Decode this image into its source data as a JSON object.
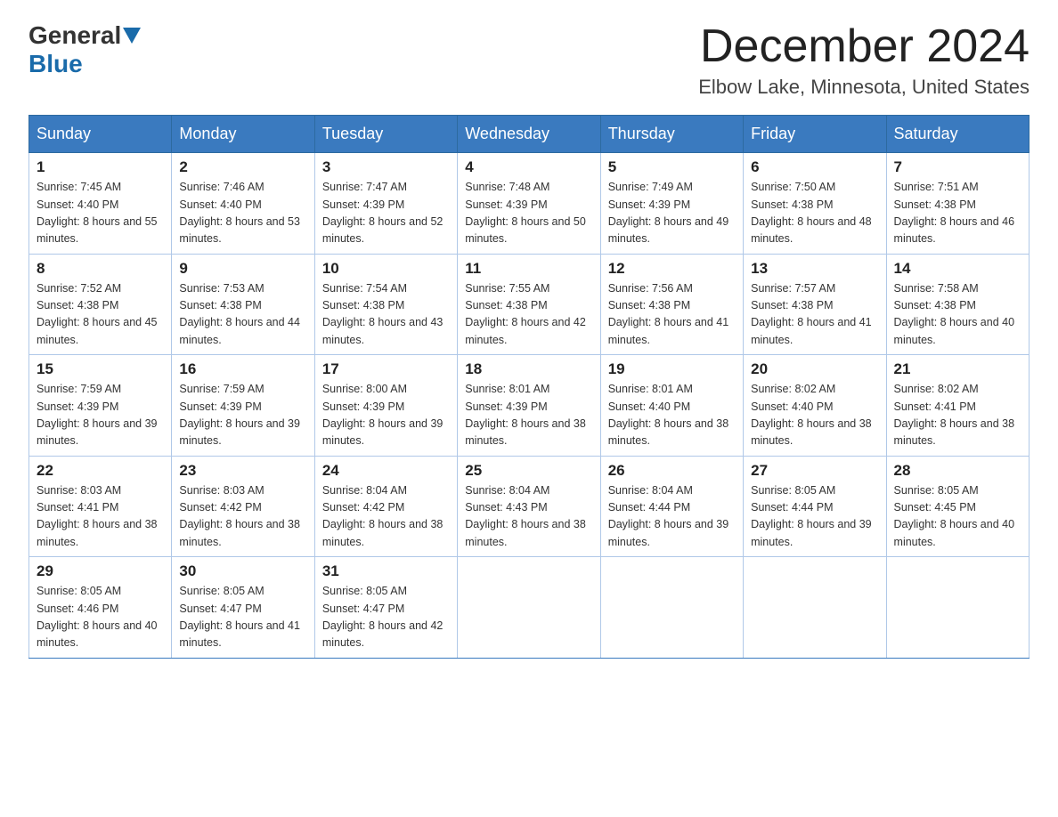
{
  "header": {
    "logo_general": "General",
    "logo_blue": "Blue",
    "month_title": "December 2024",
    "location": "Elbow Lake, Minnesota, United States"
  },
  "weekdays": [
    "Sunday",
    "Monday",
    "Tuesday",
    "Wednesday",
    "Thursday",
    "Friday",
    "Saturday"
  ],
  "weeks": [
    [
      {
        "day": "1",
        "sunrise": "7:45 AM",
        "sunset": "4:40 PM",
        "daylight": "8 hours and 55 minutes."
      },
      {
        "day": "2",
        "sunrise": "7:46 AM",
        "sunset": "4:40 PM",
        "daylight": "8 hours and 53 minutes."
      },
      {
        "day": "3",
        "sunrise": "7:47 AM",
        "sunset": "4:39 PM",
        "daylight": "8 hours and 52 minutes."
      },
      {
        "day": "4",
        "sunrise": "7:48 AM",
        "sunset": "4:39 PM",
        "daylight": "8 hours and 50 minutes."
      },
      {
        "day": "5",
        "sunrise": "7:49 AM",
        "sunset": "4:39 PM",
        "daylight": "8 hours and 49 minutes."
      },
      {
        "day": "6",
        "sunrise": "7:50 AM",
        "sunset": "4:38 PM",
        "daylight": "8 hours and 48 minutes."
      },
      {
        "day": "7",
        "sunrise": "7:51 AM",
        "sunset": "4:38 PM",
        "daylight": "8 hours and 46 minutes."
      }
    ],
    [
      {
        "day": "8",
        "sunrise": "7:52 AM",
        "sunset": "4:38 PM",
        "daylight": "8 hours and 45 minutes."
      },
      {
        "day": "9",
        "sunrise": "7:53 AM",
        "sunset": "4:38 PM",
        "daylight": "8 hours and 44 minutes."
      },
      {
        "day": "10",
        "sunrise": "7:54 AM",
        "sunset": "4:38 PM",
        "daylight": "8 hours and 43 minutes."
      },
      {
        "day": "11",
        "sunrise": "7:55 AM",
        "sunset": "4:38 PM",
        "daylight": "8 hours and 42 minutes."
      },
      {
        "day": "12",
        "sunrise": "7:56 AM",
        "sunset": "4:38 PM",
        "daylight": "8 hours and 41 minutes."
      },
      {
        "day": "13",
        "sunrise": "7:57 AM",
        "sunset": "4:38 PM",
        "daylight": "8 hours and 41 minutes."
      },
      {
        "day": "14",
        "sunrise": "7:58 AM",
        "sunset": "4:38 PM",
        "daylight": "8 hours and 40 minutes."
      }
    ],
    [
      {
        "day": "15",
        "sunrise": "7:59 AM",
        "sunset": "4:39 PM",
        "daylight": "8 hours and 39 minutes."
      },
      {
        "day": "16",
        "sunrise": "7:59 AM",
        "sunset": "4:39 PM",
        "daylight": "8 hours and 39 minutes."
      },
      {
        "day": "17",
        "sunrise": "8:00 AM",
        "sunset": "4:39 PM",
        "daylight": "8 hours and 39 minutes."
      },
      {
        "day": "18",
        "sunrise": "8:01 AM",
        "sunset": "4:39 PM",
        "daylight": "8 hours and 38 minutes."
      },
      {
        "day": "19",
        "sunrise": "8:01 AM",
        "sunset": "4:40 PM",
        "daylight": "8 hours and 38 minutes."
      },
      {
        "day": "20",
        "sunrise": "8:02 AM",
        "sunset": "4:40 PM",
        "daylight": "8 hours and 38 minutes."
      },
      {
        "day": "21",
        "sunrise": "8:02 AM",
        "sunset": "4:41 PM",
        "daylight": "8 hours and 38 minutes."
      }
    ],
    [
      {
        "day": "22",
        "sunrise": "8:03 AM",
        "sunset": "4:41 PM",
        "daylight": "8 hours and 38 minutes."
      },
      {
        "day": "23",
        "sunrise": "8:03 AM",
        "sunset": "4:42 PM",
        "daylight": "8 hours and 38 minutes."
      },
      {
        "day": "24",
        "sunrise": "8:04 AM",
        "sunset": "4:42 PM",
        "daylight": "8 hours and 38 minutes."
      },
      {
        "day": "25",
        "sunrise": "8:04 AM",
        "sunset": "4:43 PM",
        "daylight": "8 hours and 38 minutes."
      },
      {
        "day": "26",
        "sunrise": "8:04 AM",
        "sunset": "4:44 PM",
        "daylight": "8 hours and 39 minutes."
      },
      {
        "day": "27",
        "sunrise": "8:05 AM",
        "sunset": "4:44 PM",
        "daylight": "8 hours and 39 minutes."
      },
      {
        "day": "28",
        "sunrise": "8:05 AM",
        "sunset": "4:45 PM",
        "daylight": "8 hours and 40 minutes."
      }
    ],
    [
      {
        "day": "29",
        "sunrise": "8:05 AM",
        "sunset": "4:46 PM",
        "daylight": "8 hours and 40 minutes."
      },
      {
        "day": "30",
        "sunrise": "8:05 AM",
        "sunset": "4:47 PM",
        "daylight": "8 hours and 41 minutes."
      },
      {
        "day": "31",
        "sunrise": "8:05 AM",
        "sunset": "4:47 PM",
        "daylight": "8 hours and 42 minutes."
      },
      null,
      null,
      null,
      null
    ]
  ]
}
